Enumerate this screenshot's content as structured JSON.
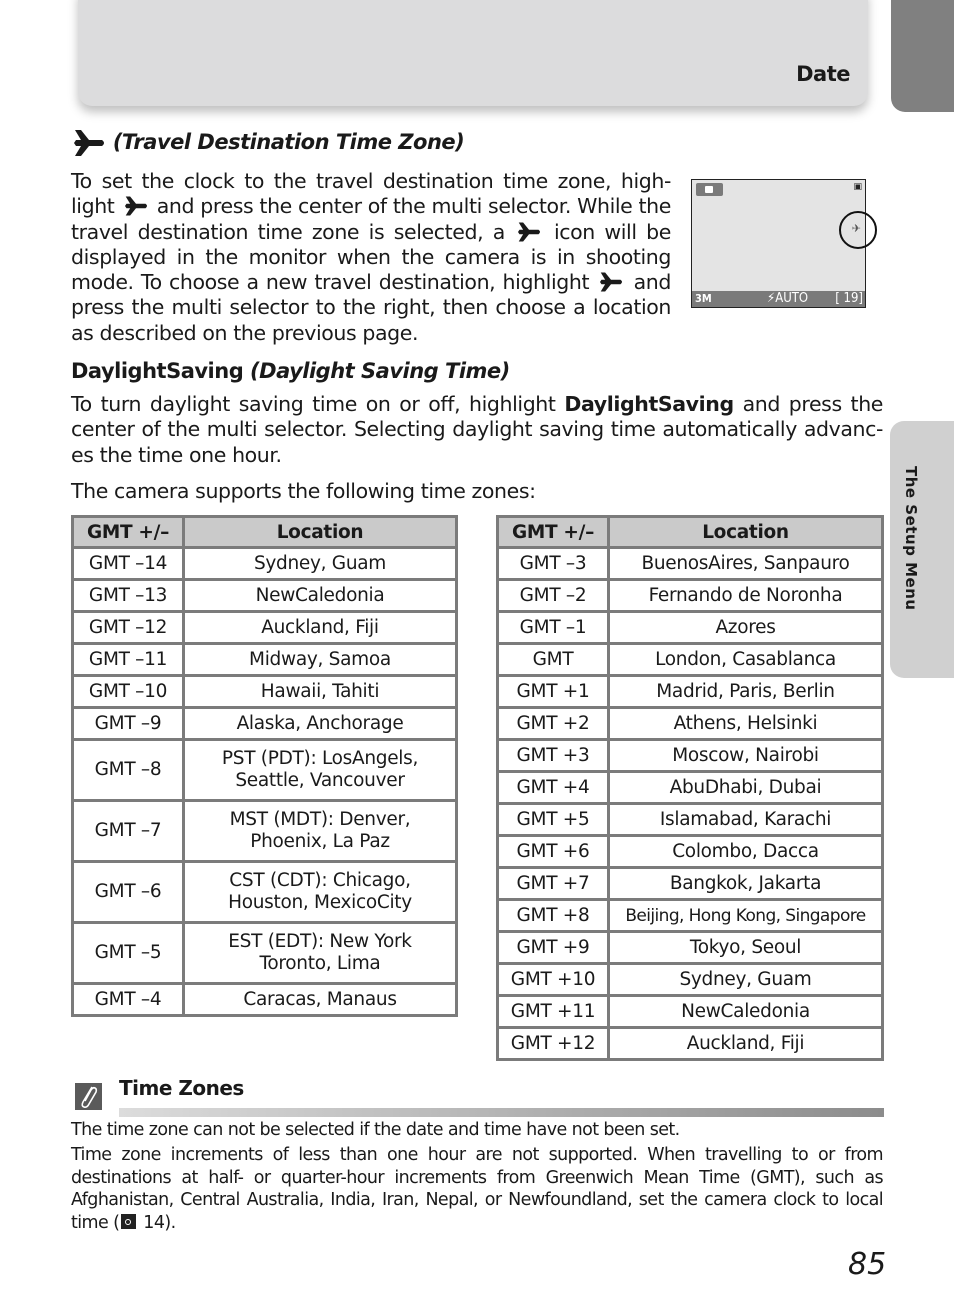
{
  "header": {
    "section": "Date"
  },
  "side_tab": {
    "label": "The Setup Menu"
  },
  "travel": {
    "icon": "airplane-icon",
    "heading": "(Travel Destination Time Zone)",
    "para_parts": [
      "To set the clock to the travel destination time zone, high-light ",
      " and press the center of the multi selector. While the travel destination time zone is selected, a ",
      " icon will be displayed in the monitor when the camera is in shooting mode. To choose a new travel destination, highlight ",
      " and press the multi selector to the right, then choose a location as described on the previous page."
    ]
  },
  "monitor": {
    "mode_icon": "camera-icon",
    "memory_icon": "internal-memory-icon",
    "travel_indicator_icon": "airplane-icon",
    "image_size": "3M",
    "flash": "⚡AUTO",
    "frames_remaining": "[  19]"
  },
  "daylight": {
    "heading_plain": "DaylightSaving ",
    "heading_italic": "(Daylight Saving Time)",
    "para_before": "To turn daylight saving time on or off, highlight ",
    "para_bold": "DaylightSaving",
    "para_after": " and press the center of the multi selector. Selecting daylight saving time automatically advanc-es the time one hour.",
    "intro": "The camera supports the following time zones:"
  },
  "tables": {
    "headers": [
      "GMT +/–",
      "Location"
    ],
    "left": [
      [
        "GMT –14",
        "Sydney, Guam"
      ],
      [
        "GMT –13",
        "NewCaledonia"
      ],
      [
        "GMT –12",
        "Auckland, Fiji"
      ],
      [
        "GMT –11",
        "Midway, Samoa"
      ],
      [
        "GMT –10",
        "Hawaii, Tahiti"
      ],
      [
        "GMT –9",
        "Alaska, Anchorage"
      ],
      [
        "GMT –8",
        "PST (PDT): LosAngels,\nSeattle, Vancouver"
      ],
      [
        "GMT –7",
        "MST (MDT): Denver,\nPhoenix, La Paz"
      ],
      [
        "GMT –6",
        "CST (CDT): Chicago,\nHouston, MexicoCity"
      ],
      [
        "GMT –5",
        "EST (EDT): New York\nToronto, Lima"
      ],
      [
        "GMT –4",
        "Caracas, Manaus"
      ]
    ],
    "right": [
      [
        "GMT –3",
        "BuenosAires, Sanpauro"
      ],
      [
        "GMT –2",
        "Fernando de Noronha"
      ],
      [
        "GMT –1",
        "Azores"
      ],
      [
        "GMT",
        "London, Casablanca"
      ],
      [
        "GMT +1",
        "Madrid, Paris, Berlin"
      ],
      [
        "GMT +2",
        "Athens, Helsinki"
      ],
      [
        "GMT +3",
        "Moscow, Nairobi"
      ],
      [
        "GMT +4",
        "AbuDhabi, Dubai"
      ],
      [
        "GMT +5",
        "Islamabad, Karachi"
      ],
      [
        "GMT +6",
        "Colombo, Dacca"
      ],
      [
        "GMT +7",
        "Bangkok, Jakarta"
      ],
      [
        "GMT +8",
        "Beijing, Hong Kong, Singapore"
      ],
      [
        "GMT +9",
        "Tokyo, Seoul"
      ],
      [
        "GMT +10",
        "Sydney, Guam"
      ],
      [
        "GMT +11",
        "NewCaledonia"
      ],
      [
        "GMT +12",
        "Auckland, Fiji"
      ]
    ]
  },
  "note": {
    "icon": "paperclip-icon",
    "title": "Time Zones",
    "line1": "The time zone can not be selected if the date and time have not been set.",
    "line2_before": "Time zone increments of less than one hour are not supported. When travelling to or from destinations at half- or quarter-hour increments from Greenwich Mean Time (GMT), such as Afghanistan, Central Australia, India, Iran, Nepal, or Newfoundland, set the camera clock to local time (",
    "ref_icon": "page-reference-icon",
    "line2_ref": " 14)."
  },
  "page_number": "85"
}
